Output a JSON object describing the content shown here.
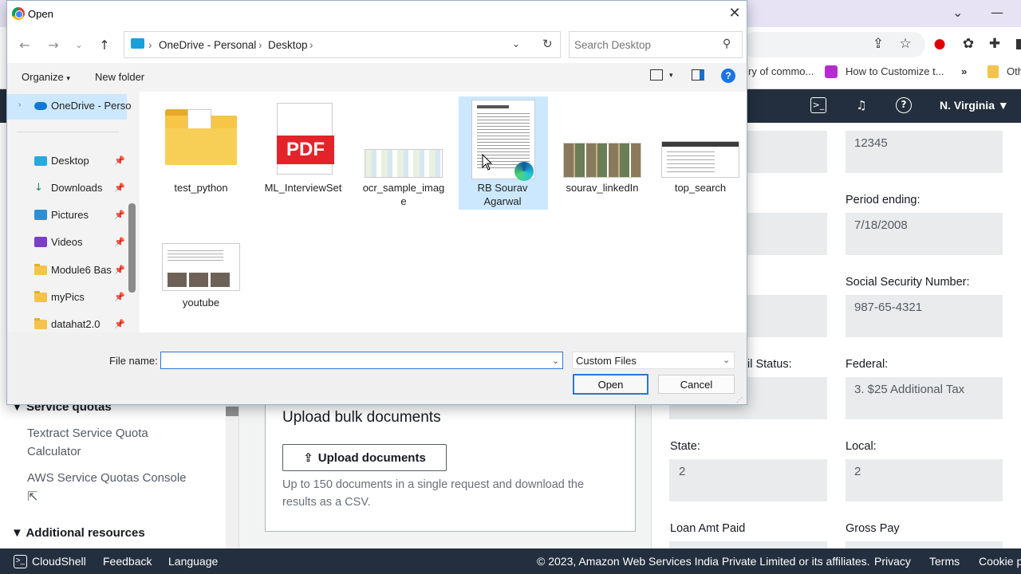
{
  "browser": {
    "tab_ctrls": {
      "chevron": "⌄",
      "minimize": "—"
    },
    "toolbar_icons": [
      "share-icon",
      "star-icon",
      "opera-icon",
      "puzzle-icon",
      "extensions-icon"
    ],
    "bookmarks": [
      {
        "label": "ry of commo...",
        "color": ""
      },
      {
        "label": "How to Customize t...",
        "color": "#b52ad1"
      },
      {
        "label": "»",
        "color": ""
      },
      {
        "label": "Oth",
        "color": "#f3c34e"
      }
    ]
  },
  "aws": {
    "region": "N. Virginia ▼",
    "sidebar": {
      "service_quotas": "Service quotas",
      "link1": "Textract Service Quota Calculator",
      "link2": "AWS Service Quotas Console",
      "additional": "Additional resources"
    },
    "upload": {
      "title": "Upload bulk documents",
      "button": "Upload documents",
      "desc": "Up to 150 documents in a single request and download the results as a CSV."
    },
    "form": {
      "period_ending_label": "Period ending:",
      "ssn_label": "Social Security Number:",
      "status_label": "il Status:",
      "federal_label": "Federal:",
      "state_label": "State:",
      "local_label": "Local:",
      "loan_label": "Loan Amt Paid",
      "gross_label": "Gross Pay",
      "val_top": "12345",
      "val_period": "7/18/2008",
      "val_ssn": "987-65-4321",
      "val_federal": "3. $25 Additional Tax",
      "val_state": "2",
      "val_local": "2"
    },
    "footer": {
      "cloudshell": "CloudShell",
      "feedback": "Feedback",
      "language": "Language",
      "copyright": "© 2023, Amazon Web Services India Private Limited or its affiliates.",
      "privacy": "Privacy",
      "terms": "Terms",
      "cookie": "Cookie pr"
    }
  },
  "dialog": {
    "title": "Open",
    "breadcrumb": {
      "root": "OneDrive - Personal",
      "folder": "Desktop"
    },
    "search_placeholder": "Search Desktop",
    "organize": "Organize",
    "new_folder": "New folder",
    "nav": {
      "onedrive": "OneDrive - Perso",
      "desktop": "Desktop",
      "downloads": "Downloads",
      "pictures": "Pictures",
      "videos": "Videos",
      "module6": "Module6 Bas",
      "mypics": "myPics",
      "datahat": "datahat2.0"
    },
    "files": {
      "f1": "test_python",
      "f2": "ML_InterviewSet",
      "f3a": "ocr_sample_imag",
      "f3b": "e",
      "f4a": "RB Sourav",
      "f4b": "Agarwal",
      "f5": "sourav_linkedIn",
      "f6": "top_search",
      "f7": "youtube"
    },
    "pdf_badge": "PDF",
    "file_name_label": "File name:",
    "file_name_value": "",
    "file_type": "Custom Files",
    "open_button": "Open",
    "cancel_button": "Cancel"
  }
}
